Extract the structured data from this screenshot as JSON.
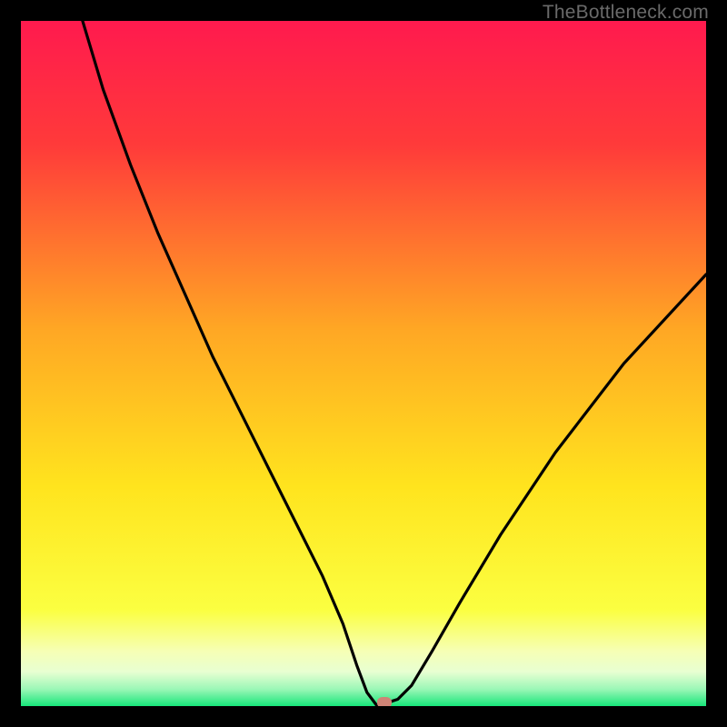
{
  "watermark": "TheBottleneck.com",
  "colors": {
    "black": "#000000",
    "watermark": "#6a6a6a",
    "curve": "#000000",
    "marker": "#cf8476",
    "gradient_stops": [
      {
        "pct": 0,
        "color": "#ff1a4e"
      },
      {
        "pct": 18,
        "color": "#ff3a3a"
      },
      {
        "pct": 45,
        "color": "#ffa724"
      },
      {
        "pct": 68,
        "color": "#ffe41e"
      },
      {
        "pct": 86,
        "color": "#fbff41"
      },
      {
        "pct": 92,
        "color": "#f6ffb5"
      },
      {
        "pct": 95,
        "color": "#e8ffd2"
      },
      {
        "pct": 97.5,
        "color": "#9cf7b7"
      },
      {
        "pct": 100,
        "color": "#17e67a"
      }
    ]
  },
  "chart_data": {
    "type": "line",
    "title": "",
    "xlabel": "",
    "ylabel": "",
    "xlim": [
      0,
      100
    ],
    "ylim": [
      0,
      100
    ],
    "grid": false,
    "series": [
      {
        "name": "bottleneck-curve",
        "x": [
          9,
          12,
          16,
          20,
          24,
          28,
          32,
          36,
          40,
          44,
          47,
          49,
          50.5,
          52,
          53.5,
          55,
          57,
          60,
          64,
          70,
          78,
          88,
          100
        ],
        "y": [
          100,
          90,
          79,
          69,
          60,
          51,
          43,
          35,
          27,
          19,
          12,
          6,
          2,
          0,
          0.5,
          1,
          3,
          8,
          15,
          25,
          37,
          50,
          63
        ]
      }
    ],
    "marker": {
      "x": 53,
      "y": 0.5
    },
    "annotations": []
  }
}
